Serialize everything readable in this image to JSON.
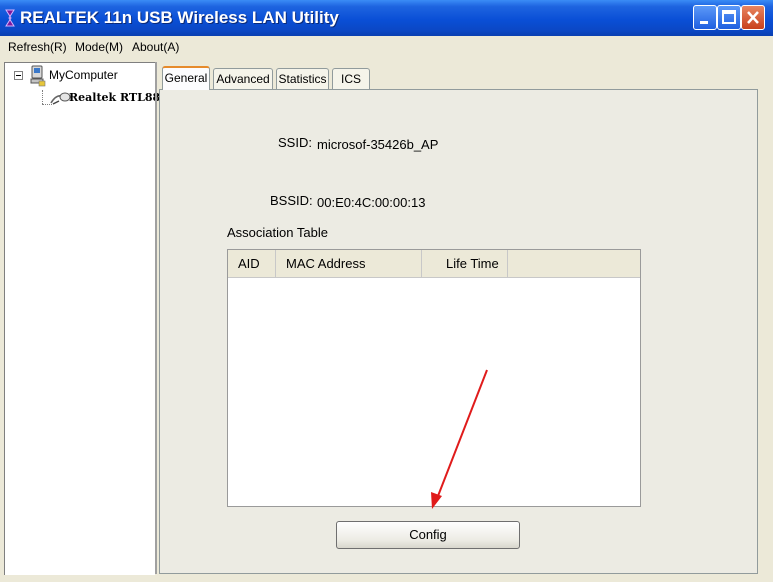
{
  "window": {
    "title": "REALTEK 11n USB Wireless LAN Utility",
    "title_bar_color": "#0a4fd6",
    "controls": [
      "minimize-icon",
      "maximize-icon",
      "close-icon"
    ]
  },
  "menu": {
    "items": [
      {
        "label": "Refresh(R)"
      },
      {
        "label": "Mode(M)"
      },
      {
        "label": "About(A)"
      }
    ]
  },
  "tree": {
    "root": {
      "label": "MyComputer",
      "icon": "computer-icon",
      "expander": "minus"
    },
    "child": {
      "label": "Realtek RTL88",
      "icon": "wireless-adapter-icon"
    }
  },
  "tabs": [
    {
      "label": "General",
      "active": true
    },
    {
      "label": "Advanced",
      "active": false
    },
    {
      "label": "Statistics",
      "active": false
    },
    {
      "label": "ICS",
      "active": false
    }
  ],
  "general": {
    "ssid_label": "SSID:",
    "ssid_value": "microsof-35426b_AP",
    "bssid_label": "BSSID:",
    "bssid_value": "00:E0:4C:00:00:13",
    "association_table_label": "Association Table",
    "columns": [
      "AID",
      "MAC Address",
      "Life Time"
    ],
    "rows": [],
    "config_button": "Config"
  },
  "annotation": {
    "type": "red-arrow",
    "color": "#e01b1b",
    "points_to": "config-button"
  }
}
